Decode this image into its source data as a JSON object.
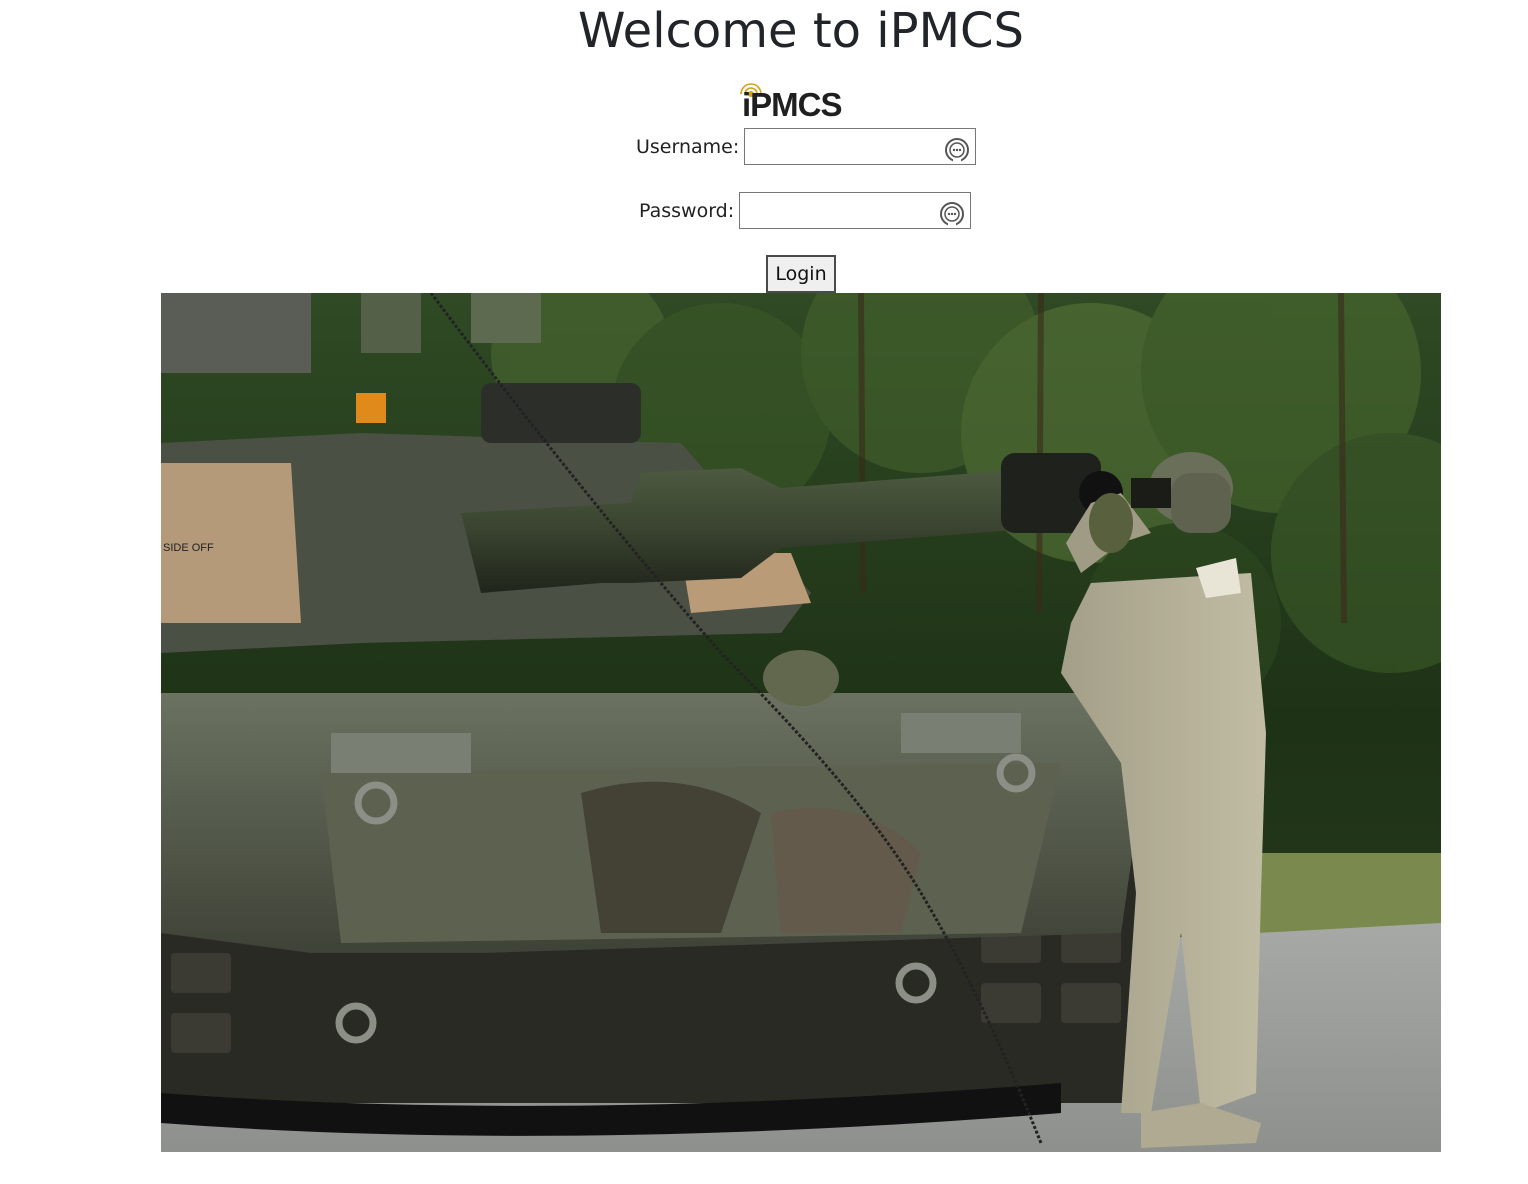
{
  "page": {
    "title": "Welcome to iPMCS"
  },
  "logo": {
    "text": "iPMCS",
    "accent_color": "#d4a017"
  },
  "form": {
    "username_label": "Username:",
    "username_value": "",
    "password_label": "Password:",
    "password_value": "",
    "login_label": "Login",
    "field_icon": "password-manager-icon"
  },
  "hero": {
    "icon": "tank-soldier-photo",
    "visible_text": "SIDE OFF"
  }
}
